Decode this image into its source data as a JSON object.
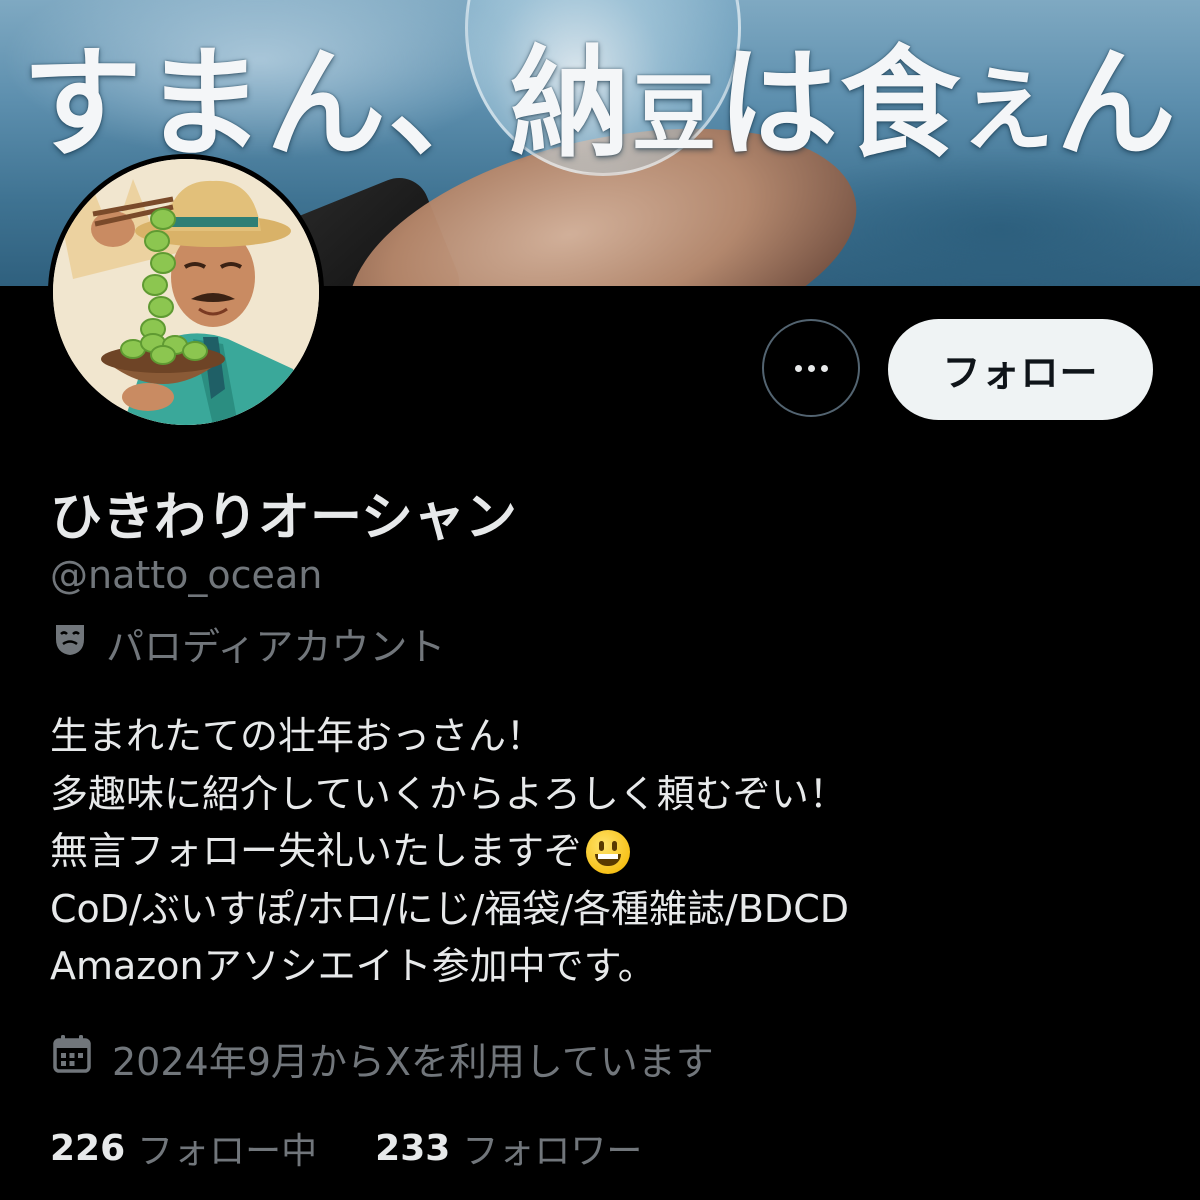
{
  "banner": {
    "tagline_parts": [
      "す",
      "ま",
      "ん",
      "、",
      "納",
      "豆",
      "は",
      "食",
      "え",
      "ん"
    ]
  },
  "profile": {
    "display_name": "ひきわりオーシャン",
    "handle": "@natto_ocean",
    "parody_label": "パロディアカウント",
    "bio_lines": [
      "生まれたての壮年おっさん！",
      "多趣味に紹介していくからよろしく頼むぞい！",
      "無言フォロー失礼いたしますぞ",
      "CoD/ぶいすぽ/ホロ/にじ/福袋/各種雑誌/BDCD",
      "Amazonアソシエイト参加中です。"
    ],
    "bio_emoji": "grinning-face-emoji",
    "joined": "2024年9月からXを利用しています",
    "following_count": "226",
    "following_label": "フォロー中",
    "followers_count": "233",
    "followers_label": "フォロワー"
  },
  "actions": {
    "more_icon": "ellipsis-icon",
    "follow_label": "フォロー"
  },
  "icons": {
    "parody": "theater-mask-icon",
    "joined": "calendar-icon"
  },
  "colors": {
    "background": "#000000",
    "text_primary": "#e7e9ea",
    "text_secondary": "#71767b",
    "follow_button_bg": "#eff3f4",
    "follow_button_text": "#0f1419",
    "outline": "#536471"
  }
}
